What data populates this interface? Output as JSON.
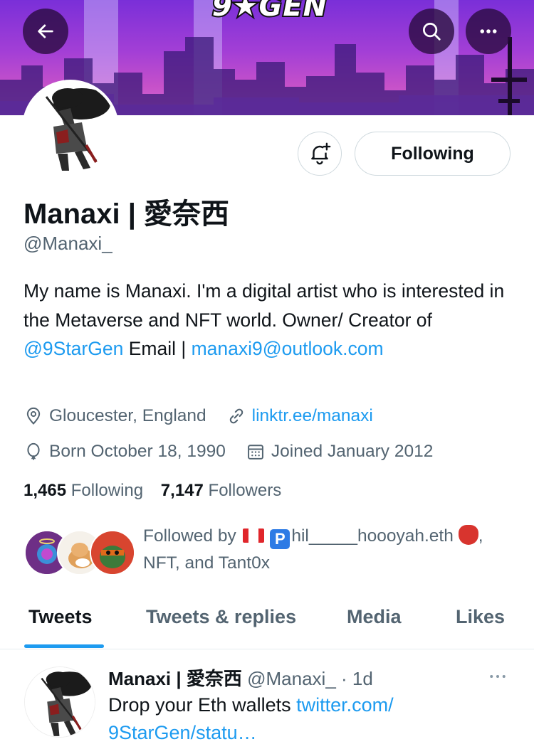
{
  "banner": {
    "logo_text": "9★GEN"
  },
  "nav": {
    "back_icon": "arrow-left-icon",
    "search_icon": "search-icon",
    "more_icon": "more-horizontal-icon"
  },
  "profile": {
    "display_name": "Manaxi | 愛奈西",
    "handle": "@Manaxi_",
    "follow_button_label": "Following",
    "bio": {
      "text_1": "My name is Manaxi. I'm a digital artist who is interested in the Metaverse and NFT world. Owner/ Creator of ",
      "mention": "@9StarGen",
      "text_2": " Email | ",
      "email": "manaxi9@outlook.com"
    },
    "location": "Gloucester, England",
    "website": "linktr.ee/manaxi",
    "birthday": "Born October 18, 1990",
    "joined": "Joined January 2012",
    "following_count": "1,465",
    "following_label": "Following",
    "followers_count": "7,147",
    "followers_label": "Followers",
    "followed_by": {
      "prefix": "Followed by",
      "name_1": "hil_____hoooyah.eth",
      "suffix": ", NFT, and Tant0x"
    }
  },
  "tabs": [
    {
      "label": "Tweets",
      "active": true
    },
    {
      "label": "Tweets & replies",
      "active": false
    },
    {
      "label": "Media",
      "active": false
    },
    {
      "label": "Likes",
      "active": false
    }
  ],
  "tweet": {
    "author_name": "Manaxi | 愛奈西",
    "author_handle": "@Manaxi_",
    "time": "· 1d",
    "text": "Drop your Eth wallets ",
    "link_line_1": "twitter.com/",
    "link_line_2": "9StarGen/statu…"
  },
  "colors": {
    "accent": "#1d9bf0",
    "text": "#0f1419",
    "secondary_text": "#536471"
  }
}
